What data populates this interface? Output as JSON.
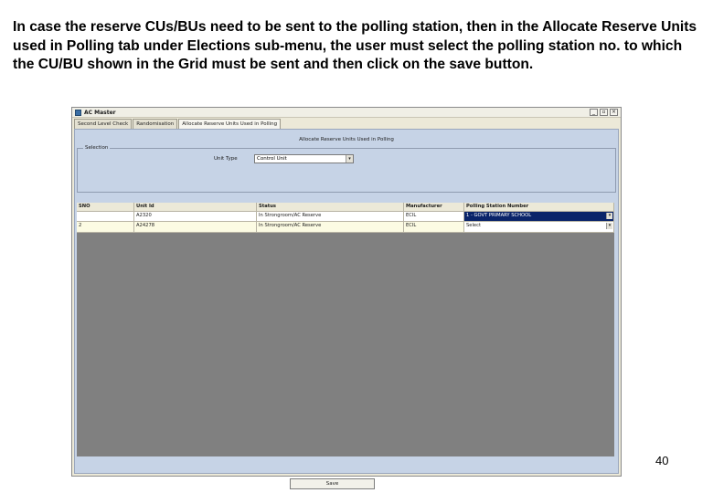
{
  "slide": {
    "paragraph": "In case the reserve CUs/BUs need to be sent to the polling station, then in the Allocate Reserve Units used in Polling tab under Elections sub-menu, the user must select the polling station no. to which the CU/BU shown in the Grid must be sent and then click on the save button.",
    "page_number": "40"
  },
  "window": {
    "title": "AC Master",
    "buttons": {
      "minimize": "_",
      "restore": "▫",
      "close": "×"
    }
  },
  "tabs": [
    {
      "label": "Second Level Check",
      "active": false
    },
    {
      "label": "Randomisation",
      "active": false
    },
    {
      "label": "Allocate Reserve Units Used in Polling",
      "active": true
    }
  ],
  "panel": {
    "heading": "Allocate Reserve Units Used in Polling",
    "selection_legend": "Selection",
    "unit_type_label": "Unit Type",
    "unit_type_value": "Control Unit"
  },
  "grid": {
    "columns": [
      "SNO",
      "Unit Id",
      "Status",
      "Manufacturer",
      "Polling Station Number"
    ],
    "rows": [
      {
        "sno": "",
        "unit_id": "A2320",
        "status": "In Strongroom/AC Reserve",
        "manufacturer": "ECIL",
        "polling_station": "1 - GOVT PRIMARY SCHOOL"
      },
      {
        "sno": "2",
        "unit_id": "A24278",
        "status": "In Strongroom/AC Reserve",
        "manufacturer": "ECIL",
        "polling_station": "Select"
      }
    ]
  },
  "save_label": "Save",
  "colors": {
    "panel_bg": "#c6d3e6",
    "grid_bg": "#808080",
    "selection_highlight": "#0a246a"
  },
  "icons": {
    "dropdown": "chevron-down-icon",
    "app": "app-icon"
  }
}
